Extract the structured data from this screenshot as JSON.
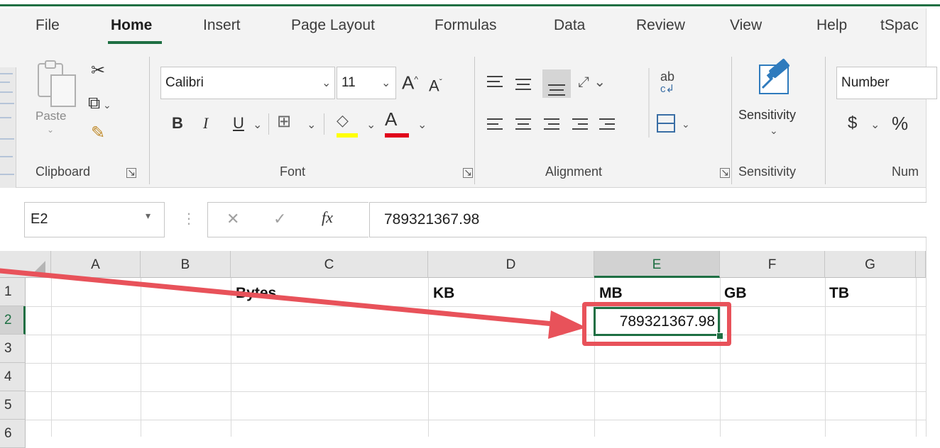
{
  "tabs": [
    "File",
    "Home",
    "Insert",
    "Page Layout",
    "Formulas",
    "Data",
    "Review",
    "View",
    "Help",
    "tSpac"
  ],
  "active_tab": "Home",
  "clipboard": {
    "paste_label": "Paste",
    "group_label": "Clipboard"
  },
  "font": {
    "name": "Calibri",
    "size": "11",
    "bold": "B",
    "italic": "I",
    "underline": "U",
    "font_color_glyph": "A",
    "grow_glyph": "A",
    "shrink_glyph": "A",
    "group_label": "Font",
    "highlight_color": "#ffff00",
    "font_color": "#e0001b"
  },
  "alignment": {
    "group_label": "Alignment",
    "wrap_glyph": "ab"
  },
  "sensitivity": {
    "button_label": "Sensitivity",
    "group_label": "Sensitivity"
  },
  "number": {
    "format": "Number",
    "currency": "$",
    "percent": "%",
    "group_label": "Num"
  },
  "formula_bar": {
    "name_box": "E2",
    "fx": "fx",
    "value": "789321367.98"
  },
  "grid": {
    "columns": [
      "A",
      "B",
      "C",
      "D",
      "E",
      "F",
      "G"
    ],
    "rows": [
      "1",
      "2",
      "3",
      "4",
      "5",
      "6"
    ],
    "row1": {
      "C": "Bytes",
      "D": "KB",
      "E": "MB",
      "F": "GB",
      "G": "TB"
    },
    "row2": {
      "E": "789321367.98"
    },
    "selected_cell": "E2"
  },
  "colors": {
    "accent": "#1e6f43",
    "annotation": "#e8525a"
  }
}
